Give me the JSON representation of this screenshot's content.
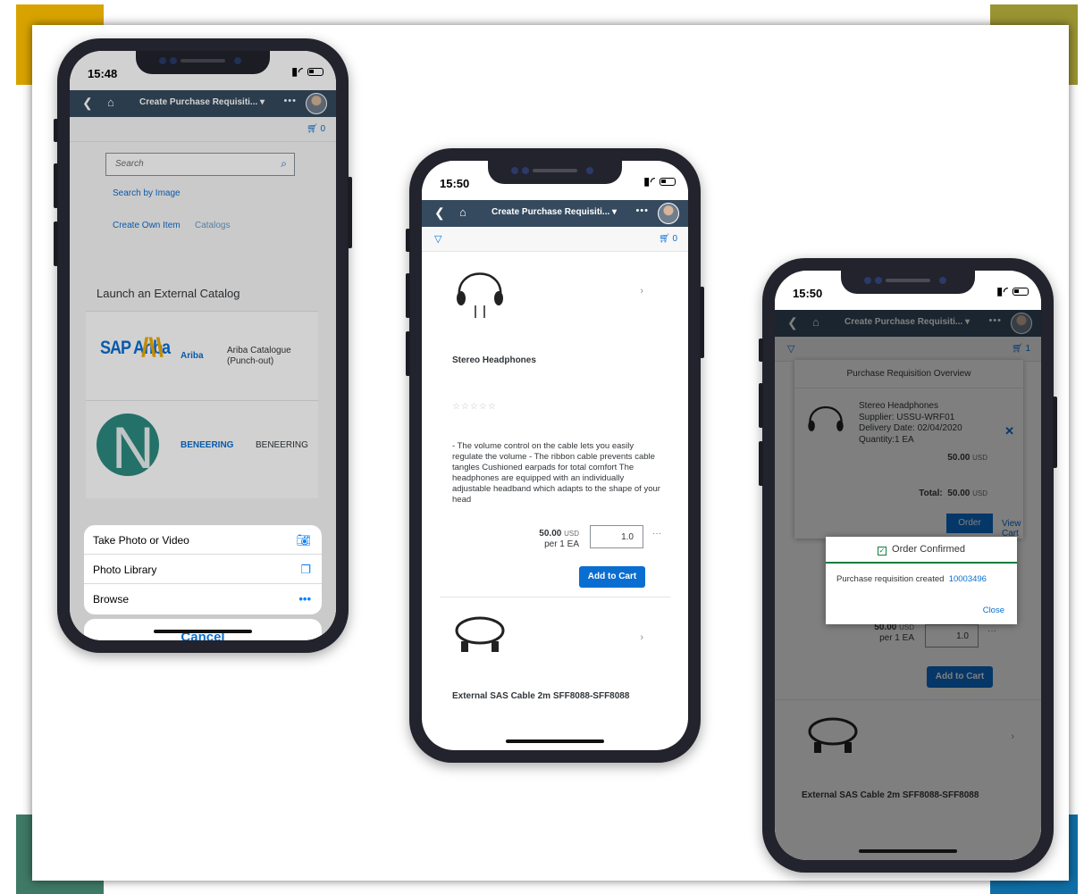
{
  "colors": {
    "corner_top_left": "#d8a300",
    "corner_top_right": "#9a9432",
    "corner_bottom_left": "#3f7a66",
    "corner_bottom_right": "#0f6fa8",
    "shellbar": "#354a5f",
    "accent": "#0a6ed1",
    "success": "#107e3e"
  },
  "phone1": {
    "time": "15:48",
    "app_title": "Create Purchase Requisiti...",
    "cart_count": "0",
    "search_placeholder": "Search",
    "search_by_image": "Search by Image",
    "create_own_item": "Create Own Item",
    "catalogs": "Catalogs",
    "launch_title": "Launch an External Catalog",
    "catalogs_list": [
      {
        "logo": "SAP Ariba",
        "name": "Ariba",
        "description_line1": "Ariba Catalogue",
        "description_line2": "(Punch-out)"
      },
      {
        "logo": "N",
        "name": "BENEERING",
        "description": "BENEERING"
      }
    ],
    "action_sheet": {
      "take_photo": "Take Photo or Video",
      "photo_library": "Photo Library",
      "browse": "Browse",
      "cancel": "Cancel"
    }
  },
  "phone2": {
    "time": "15:50",
    "app_title": "Create Purchase Requisiti...",
    "cart_count": "0",
    "product1": {
      "title": "Stereo Headphones",
      "rating": "☆☆☆☆☆",
      "description": "- The volume control on the cable lets you easily regulate the volume - The ribbon cable prevents cable tangles Cushioned earpads for total comfort The headphones are equipped with an individually adjustable headband which adapts to the shape of your head",
      "price": "50.00",
      "currency": "USD",
      "unit": "per 1 EA",
      "quantity": "1.0",
      "add_to_cart": "Add to Cart"
    },
    "product2": {
      "title": "External SAS Cable 2m SFF8088-SFF8088"
    }
  },
  "phone3": {
    "time": "15:50",
    "app_title": "Create Purchase Requisiti...",
    "cart_count": "1",
    "overview": {
      "title": "Purchase Requisition Overview",
      "item_name": "Stereo Headphones",
      "supplier": "Supplier:  USSU-WRF01",
      "delivery": "Delivery Date: 02/04/2020",
      "quantity": "Quantity:1 EA",
      "item_price": "50.00",
      "currency": "USD",
      "total_label": "Total:",
      "total_value": "50.00",
      "view_cart": "View Cart",
      "order": "Order"
    },
    "dialog": {
      "title": "Order Confirmed",
      "message": "Purchase requisition created",
      "req_number": "10003496",
      "close": "Close"
    },
    "product1": {
      "price": "50.00",
      "currency": "USD",
      "unit": "per 1 EA",
      "quantity": "1.0",
      "add_to_cart": "Add to Cart"
    },
    "product2": {
      "title": "External SAS Cable 2m SFF8088-SFF8088"
    }
  }
}
